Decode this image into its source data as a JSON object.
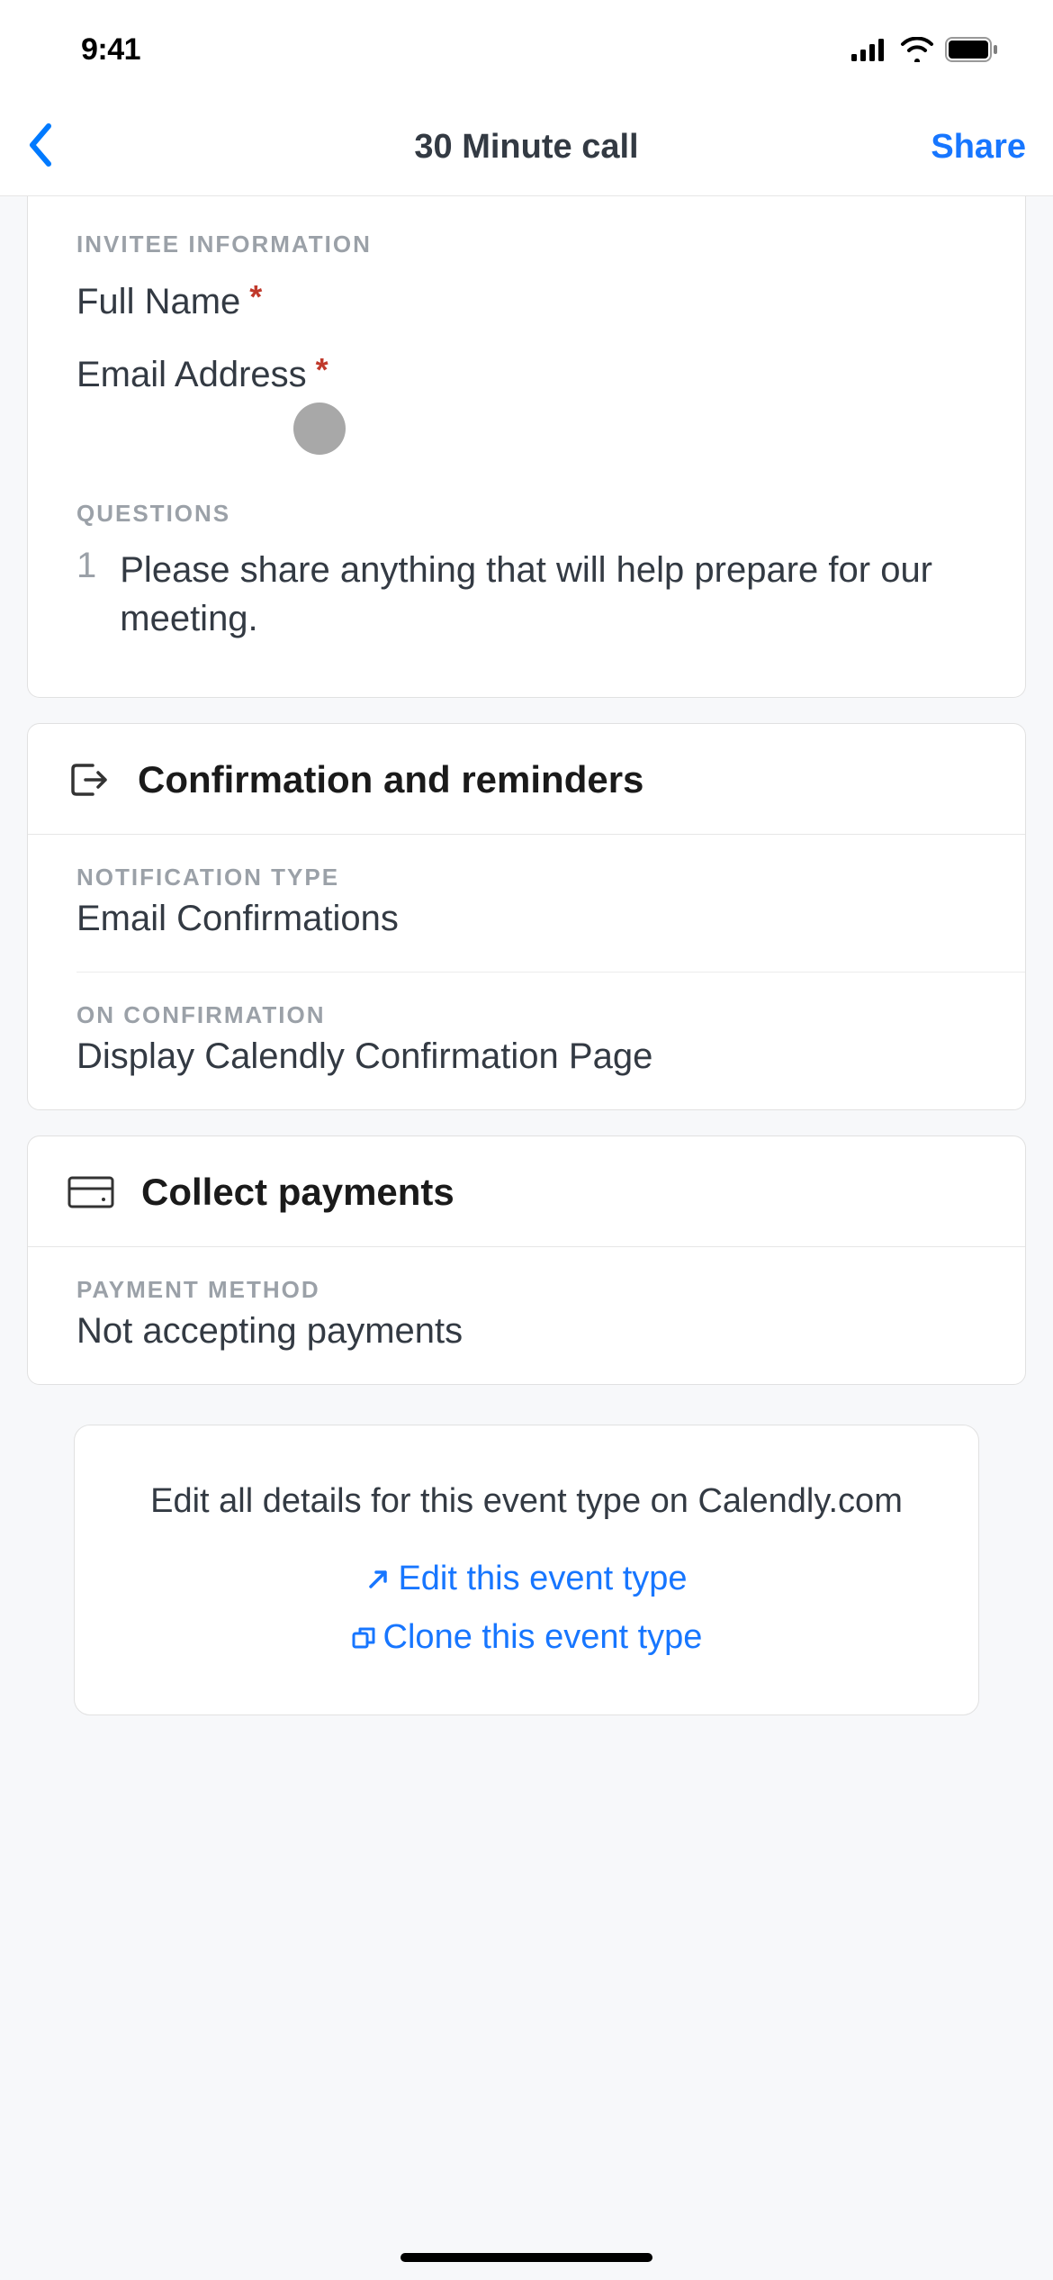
{
  "status": {
    "time": "9:41"
  },
  "nav": {
    "title": "30 Minute call",
    "share": "Share"
  },
  "invitee": {
    "header": "INVITEE INFORMATION",
    "full_name_label": "Full Name",
    "email_label": "Email Address"
  },
  "questions": {
    "header": "QUESTIONS",
    "items": [
      {
        "num": "1",
        "text": "Please share anything that will help prepare for our meeting."
      }
    ]
  },
  "confirm": {
    "title": "Confirmation and reminders",
    "notif_label": "NOTIFICATION TYPE",
    "notif_value": "Email Confirmations",
    "onconf_label": "ON CONFIRMATION",
    "onconf_value": "Display Calendly Confirmation Page"
  },
  "payments": {
    "title": "Collect payments",
    "method_label": "PAYMENT METHOD",
    "method_value": "Not accepting payments"
  },
  "footer": {
    "text": "Edit all details for this event type on Calendly.com",
    "edit_link": "Edit this event type",
    "clone_link": "Clone this event type"
  }
}
